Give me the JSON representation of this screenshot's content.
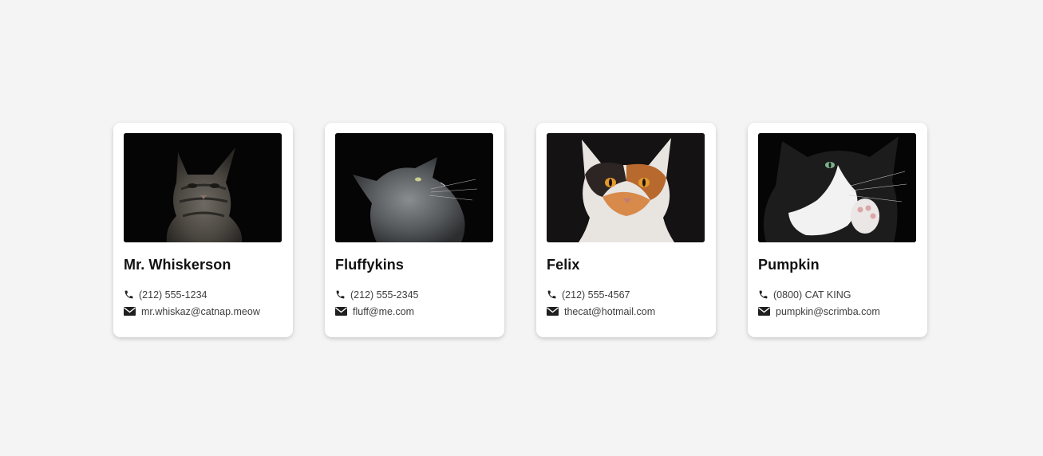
{
  "colors": {
    "background": "#f4f4f4",
    "card": "#ffffff",
    "name_text": "#111111",
    "info_text": "#3d3d3d",
    "icon": "#1f1f1f"
  },
  "contacts": [
    {
      "name": "Mr. Whiskerson",
      "phone": "(212) 555-1234",
      "email": "mr.whiskaz@catnap.meow",
      "photo_icon": "tabby-cat-photo",
      "phone_icon": "phone-icon",
      "email_icon": "envelope-icon"
    },
    {
      "name": "Fluffykins",
      "phone": "(212) 555-2345",
      "email": "fluff@me.com",
      "photo_icon": "grey-fluffy-cat-photo",
      "phone_icon": "phone-icon",
      "email_icon": "envelope-icon"
    },
    {
      "name": "Felix",
      "phone": "(212) 555-4567",
      "email": "thecat@hotmail.com",
      "photo_icon": "calico-cat-photo",
      "phone_icon": "phone-icon",
      "email_icon": "envelope-icon"
    },
    {
      "name": "Pumpkin",
      "phone": "(0800) CAT KING",
      "email": "pumpkin@scrimba.com",
      "photo_icon": "tuxedo-cat-photo",
      "phone_icon": "phone-icon",
      "email_icon": "envelope-icon"
    }
  ]
}
